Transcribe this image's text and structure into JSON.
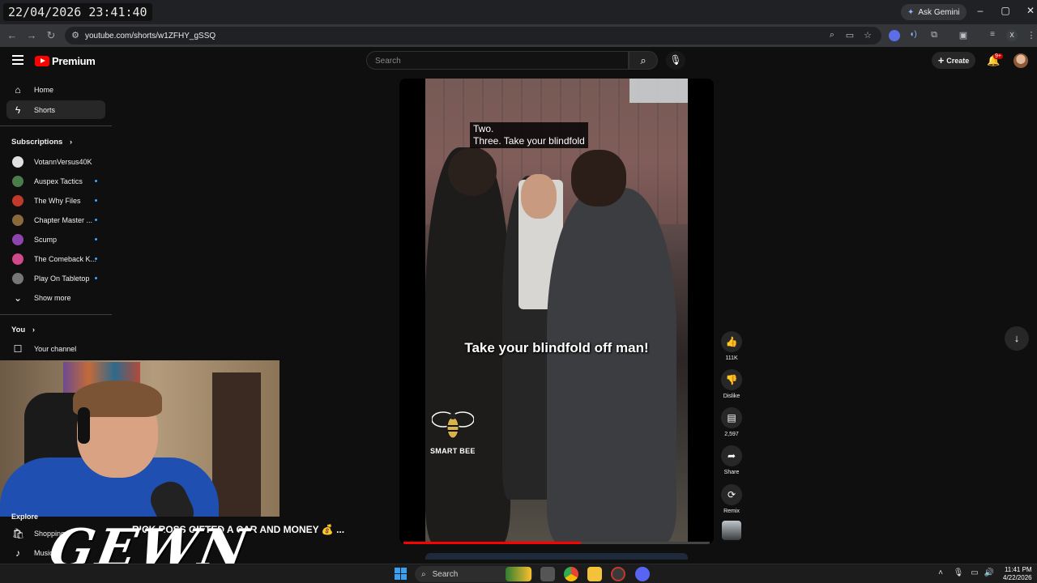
{
  "overlay": {
    "clock": "22/04/2026 23:41:40"
  },
  "browser": {
    "url": "youtube.com/shorts/w1ZFHY_gSSQ",
    "gemini_label": "Ask Gemini",
    "profile_initial": "X",
    "window_controls": {
      "minimize": "–",
      "maximize": "▢",
      "close": "✕"
    }
  },
  "header": {
    "logo_text": "Premium",
    "search_placeholder": "Search",
    "create_label": "Create",
    "notification_count": "9+"
  },
  "sidebar": {
    "main": [
      {
        "label": "Home",
        "icon": "home-icon",
        "active": false
      },
      {
        "label": "Shorts",
        "icon": "shorts-icon",
        "active": true
      }
    ],
    "subscriptions_heading": "Subscriptions",
    "subscriptions": [
      {
        "label": "VotannVersus40K",
        "color": "#e0e0e0",
        "new": false
      },
      {
        "label": "Auspex Tactics",
        "color": "#4a7d4a",
        "new": true
      },
      {
        "label": "The Why Files",
        "color": "#c0392b",
        "new": true
      },
      {
        "label": "Chapter Master ...",
        "color": "#8a6a3a",
        "new": true
      },
      {
        "label": "Scump",
        "color": "#8e44ad",
        "new": true
      },
      {
        "label": "The Comeback K...",
        "color": "#d04a8a",
        "new": true
      },
      {
        "label": "Play On Tabletop",
        "color": "#777777",
        "new": true
      }
    ],
    "show_more": "Show more",
    "you_heading": "You",
    "your_channel": "Your channel",
    "explore_heading": "Explore",
    "explore": [
      {
        "label": "Shopping",
        "icon": "shopping-bag-icon"
      },
      {
        "label": "Music",
        "icon": "music-note-icon"
      }
    ]
  },
  "short": {
    "caption_top_line1": "Two.",
    "caption_top_line2": "Three. Take your blindfold",
    "caption_main": "Take your blindfold off man!",
    "watermark": "SMART BEE",
    "progress": 0.58,
    "actions": {
      "like_count": "111K",
      "dislike_label": "Dislike",
      "comment_count": "2,597",
      "share_label": "Share",
      "remix_label": "Remix"
    }
  },
  "stream": {
    "video_title": "RICK ROSS GIFTED A CAR AND MONEY 💰 ...",
    "logo": "GEWN"
  },
  "taskbar": {
    "search_label": "Search",
    "time": "11:41 PM",
    "date": "4/22/2026"
  },
  "colors": {
    "brand_red": "#ff0000",
    "accent_blue": "#3ea6ff",
    "background": "#0f0f0f"
  }
}
